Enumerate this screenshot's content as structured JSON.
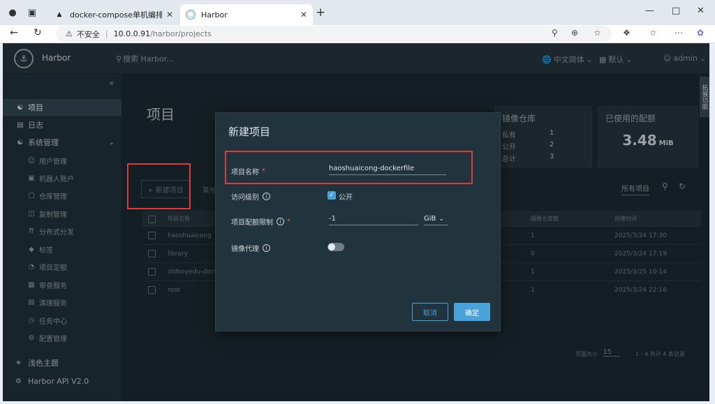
{
  "browser": {
    "tabs": [
      {
        "title": "docker-compose单机编排及企业",
        "active": false
      },
      {
        "title": "Harbor",
        "active": true
      }
    ],
    "address": {
      "security_label": "不安全",
      "host": "10.0.0.91",
      "path": "/harbor/projects"
    }
  },
  "header": {
    "brand": "Harbor",
    "search_placeholder": "搜索 Harbor...",
    "language": "中文简体",
    "theme_default": "默认",
    "user": "admin",
    "side_tag": "拓展功能"
  },
  "sidebar": {
    "items": [
      {
        "label": "项目",
        "icon": "project-icon",
        "level": "top",
        "active": true
      },
      {
        "label": "日志",
        "icon": "log-icon",
        "level": "top",
        "active": false
      },
      {
        "label": "系统管理",
        "icon": "admin-icon",
        "level": "top",
        "active": false
      },
      {
        "label": "用户管理",
        "icon": "user-icon",
        "level": "sub",
        "active": false
      },
      {
        "label": "机器人账户",
        "icon": "robot-icon",
        "level": "sub",
        "active": false
      },
      {
        "label": "仓库管理",
        "icon": "registry-icon",
        "level": "sub",
        "active": false
      },
      {
        "label": "复制管理",
        "icon": "replication-icon",
        "level": "sub",
        "active": false
      },
      {
        "label": "分布式分发",
        "icon": "distribution-icon",
        "level": "sub",
        "active": false
      },
      {
        "label": "标签",
        "icon": "tag-icon",
        "level": "sub",
        "active": false
      },
      {
        "label": "项目定额",
        "icon": "quota-icon",
        "level": "sub",
        "active": false
      },
      {
        "label": "审查服务",
        "icon": "scanner-icon",
        "level": "sub",
        "active": false
      },
      {
        "label": "清理服务",
        "icon": "clean-icon",
        "level": "sub",
        "active": false
      },
      {
        "label": "任务中心",
        "icon": "task-icon",
        "level": "sub",
        "active": false
      },
      {
        "label": "配置管理",
        "icon": "config-icon",
        "level": "sub",
        "active": false
      }
    ],
    "theme_toggle": "浅色主题",
    "api_link": "Harbor API V2.0"
  },
  "main": {
    "title": "项目",
    "repo_card": {
      "title": "镜像仓库",
      "rows": [
        {
          "label": "私有",
          "value": "1"
        },
        {
          "label": "公开",
          "value": "2"
        },
        {
          "label": "总计",
          "value": "3"
        }
      ]
    },
    "quota_card": {
      "title": "已使用的配额",
      "value": "3.48",
      "unit": "MiB"
    },
    "new_project_button": "+ 新建项目",
    "other_label": "其他",
    "filter_label": "所有项目",
    "table": {
      "headers": [
        "项目名称",
        "镜像仓库数",
        "创建时间"
      ],
      "rows": [
        {
          "name": "haoshuaicong",
          "repos": "1",
          "created": "2025/3/24 17:30"
        },
        {
          "name": "library",
          "repos": "0",
          "created": "2025/3/24 17:19"
        },
        {
          "name": "oldboyedu-dockerfile",
          "repos": "1",
          "created": "2025/3/25 10:14"
        },
        {
          "name": "root",
          "repos": "1",
          "created": "2025/3/24 22:16"
        }
      ],
      "page_size_label": "页面大小",
      "page_size": "15",
      "summary": "1 - 4 共计 4 条记录"
    }
  },
  "modal": {
    "title": "新建项目",
    "name_label": "项目名称",
    "name_value": "haoshuaicong-dockerfile",
    "access_label": "访问级别",
    "public_label": "公开",
    "public_checked": true,
    "quota_label": "项目配额限制",
    "quota_value": "-1",
    "quota_unit": "GiB",
    "proxy_label": "镜像代理",
    "proxy_enabled": false,
    "cancel_label": "取消",
    "ok_label": "确定"
  },
  "colors": {
    "accent": "#4aa3d8",
    "highlight": "#e23a3a",
    "background": "#1b2a32"
  }
}
